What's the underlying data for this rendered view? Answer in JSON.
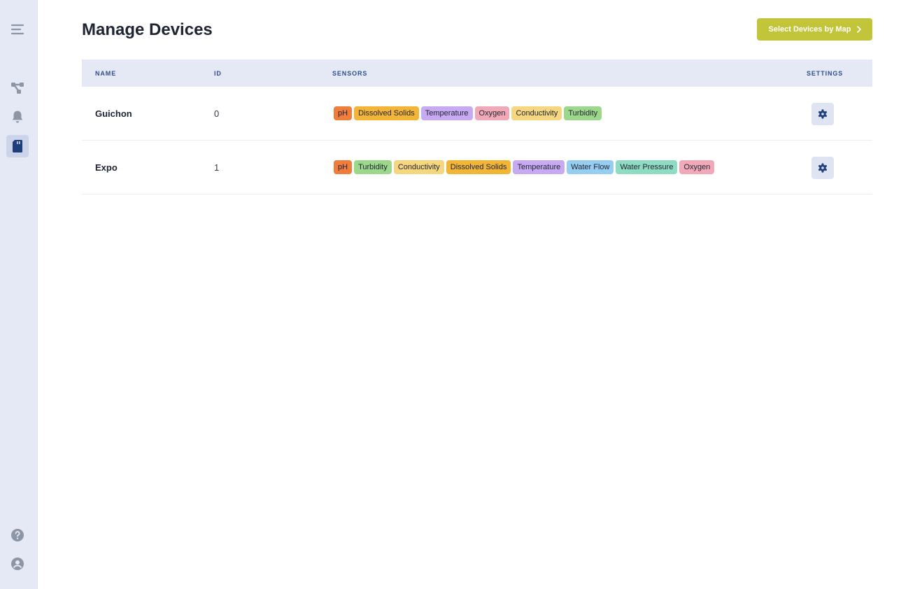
{
  "page": {
    "title": "Manage Devices"
  },
  "header": {
    "map_button_label": "Select Devices by Map"
  },
  "table": {
    "columns": {
      "name": "NAME",
      "id": "ID",
      "sensors": "SENSORS",
      "settings": "SETTINGS"
    },
    "rows": [
      {
        "name": "Guichon",
        "id": "0",
        "sensors": [
          {
            "label": "pH",
            "color": "#ef7d3c"
          },
          {
            "label": "Dissolved Solids",
            "color": "#f2b535"
          },
          {
            "label": "Temperature",
            "color": "#c8aaf3"
          },
          {
            "label": "Oxygen",
            "color": "#f2a9b7"
          },
          {
            "label": "Conductivity",
            "color": "#f6d67f"
          },
          {
            "label": "Turbidity",
            "color": "#9dd78b"
          }
        ]
      },
      {
        "name": "Expo",
        "id": "1",
        "sensors": [
          {
            "label": "pH",
            "color": "#ef7d3c"
          },
          {
            "label": "Turbidity",
            "color": "#9dd78b"
          },
          {
            "label": "Conductivity",
            "color": "#f6d67f"
          },
          {
            "label": "Dissolved Solids",
            "color": "#f2b535"
          },
          {
            "label": "Temperature",
            "color": "#c8aaf3"
          },
          {
            "label": "Water Flow",
            "color": "#96cdf1"
          },
          {
            "label": "Water Pressure",
            "color": "#8fdcc3"
          },
          {
            "label": "Oxygen",
            "color": "#f2a9b7"
          }
        ]
      }
    ]
  },
  "sidebar": {
    "items": [
      {
        "icon": "menu-icon"
      },
      {
        "icon": "network-icon"
      },
      {
        "icon": "bell-icon"
      },
      {
        "icon": "sd-card-icon",
        "active": true
      },
      {
        "icon": "help-icon"
      },
      {
        "icon": "user-icon"
      }
    ]
  },
  "colors": {
    "accent": "#c2c43a",
    "sidebar_bg": "#e5e9f6",
    "icon_muted": "#8e96a6",
    "icon_active": "#1e3f7a"
  }
}
